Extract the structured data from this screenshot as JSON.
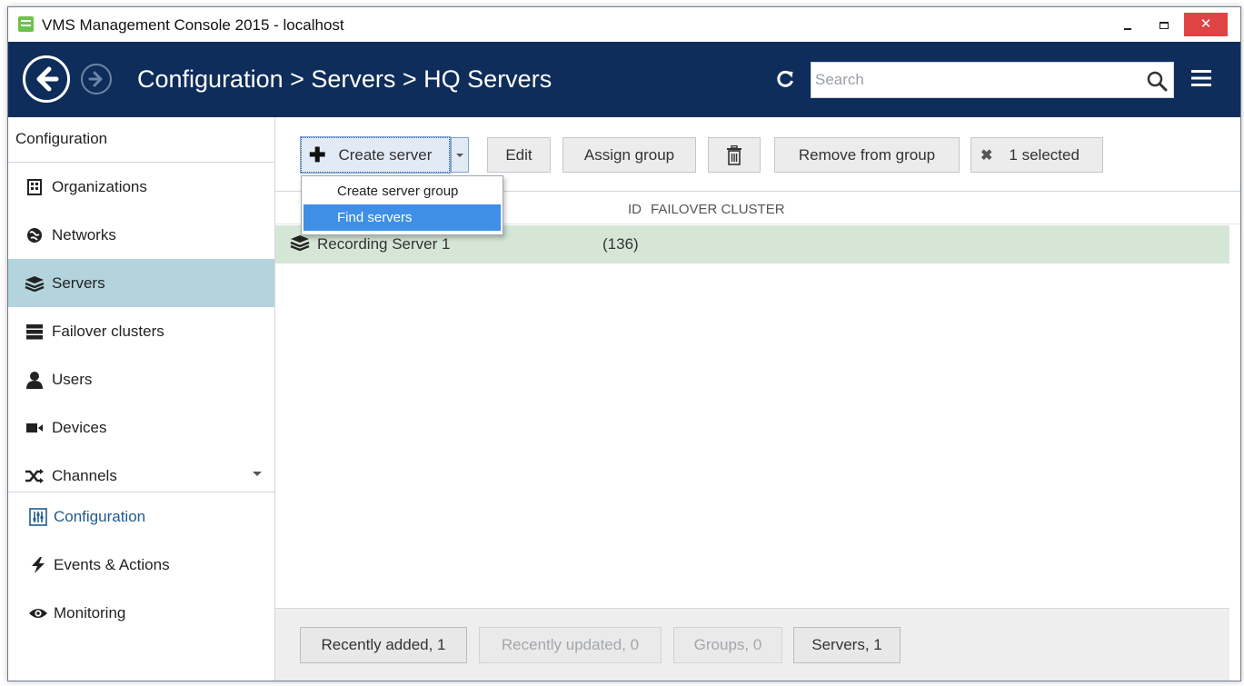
{
  "window": {
    "title": "VMS Management Console 2015 - localhost",
    "minimize": "minimize",
    "maximize": "maximize",
    "close_glyph": "✕"
  },
  "header": {
    "breadcrumb": "Configuration > Servers > HQ Servers",
    "search_placeholder": "Search",
    "background": "#0f2d5a"
  },
  "sidebar": {
    "heading": "Configuration",
    "items": [
      {
        "label": "Organizations",
        "icon": "building-icon"
      },
      {
        "label": "Networks",
        "icon": "network-globe-icon"
      },
      {
        "label": "Servers",
        "icon": "server-stack-icon",
        "active": true
      },
      {
        "label": "Failover clusters",
        "icon": "cluster-icon"
      },
      {
        "label": "Users",
        "icon": "user-icon"
      },
      {
        "label": "Devices",
        "icon": "camera-icon"
      },
      {
        "label": "Channels",
        "icon": "shuffle-icon"
      }
    ],
    "sections": [
      {
        "label": "Configuration",
        "icon": "config-sliders-icon",
        "current": true
      },
      {
        "label": "Events & Actions",
        "icon": "lightning-icon"
      },
      {
        "label": "Monitoring",
        "icon": "eye-icon"
      }
    ],
    "active_color": "#b3d4dc"
  },
  "toolbar": {
    "create": "Create server",
    "edit": "Edit",
    "assign_group": "Assign group",
    "remove_from_group": "Remove from group",
    "selected": "1 selected"
  },
  "dropdown": {
    "items": [
      "Create server group",
      "Find servers"
    ],
    "highlighted": "Find servers",
    "highlight_color": "#3f8fe6"
  },
  "table": {
    "columns": [
      "ID",
      "FAILOVER CLUSTER"
    ],
    "rows": [
      {
        "name": "Recording Server 1",
        "id": "(136)",
        "selected": true
      }
    ],
    "row_selected_color": "#d5e6d6"
  },
  "footer": {
    "filters": [
      {
        "label": "Recently added, 1",
        "enabled": true
      },
      {
        "label": "Recently updated, 0",
        "enabled": false
      },
      {
        "label": "Groups, 0",
        "enabled": false
      },
      {
        "label": "Servers, 1",
        "enabled": true
      }
    ]
  }
}
